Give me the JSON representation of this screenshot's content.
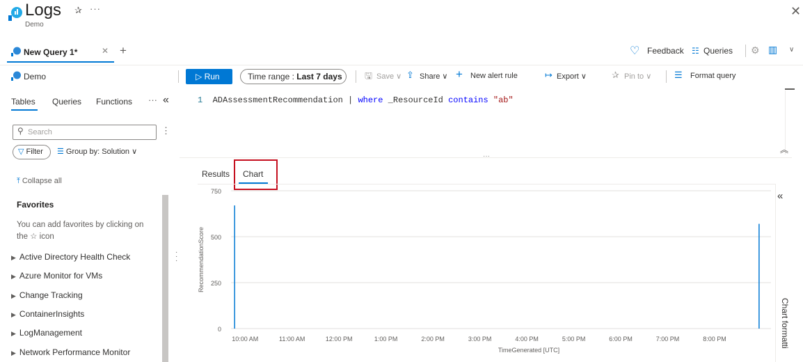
{
  "app": {
    "title": "Logs",
    "subtitle": "Demo"
  },
  "query_tab": {
    "label": "New Query 1*"
  },
  "top_actions": {
    "feedback": "Feedback",
    "queries": "Queries"
  },
  "scope": {
    "label": "Demo"
  },
  "toolbar": {
    "run": "Run",
    "time_range_label": "Time range : ",
    "time_range_value": "Last 7 days",
    "save": "Save",
    "share": "Share",
    "new_alert": "New alert rule",
    "export": "Export",
    "pin_to": "Pin to",
    "format_query": "Format query"
  },
  "left_panel": {
    "tabs": [
      "Tables",
      "Queries",
      "Functions"
    ],
    "search_placeholder": "Search",
    "filter": "Filter",
    "group_by": "Group by: Solution",
    "collapse_all": "Collapse all",
    "favorites_title": "Favorites",
    "favorites_hint": "You can add favorites by clicking on the ☆ icon",
    "solutions": [
      "Active Directory Health Check",
      "Azure Monitor for VMs",
      "Change Tracking",
      "ContainerInsights",
      "LogManagement",
      "Network Performance Monitor"
    ]
  },
  "editor": {
    "line_number": "1",
    "table": "ADAssessmentRecommendation",
    "pipe": " | ",
    "where": "where",
    "field": " _ResourceId ",
    "op": "contains",
    "value": "\"ab\""
  },
  "results_tabs": {
    "results": "Results",
    "chart": "Chart"
  },
  "chart_formatting_label": "Chart formatti",
  "colors": {
    "accent": "#0078d4",
    "highlight_box": "#c50f1f"
  },
  "chart_data": {
    "type": "bar",
    "ylabel": "RecommendationScore",
    "xlabel": "TimeGenerated [UTC]",
    "ylim": [
      0,
      750
    ],
    "yticks": [
      "0",
      "250",
      "500",
      "750"
    ],
    "xticks": [
      "10:00 AM",
      "11:00 AM",
      "12:00 PM",
      "1:00 PM",
      "2:00 PM",
      "3:00 PM",
      "4:00 PM",
      "5:00 PM",
      "6:00 PM",
      "7:00 PM",
      "8:00 PM"
    ],
    "xlim_hours": [
      9.7,
      21.2
    ],
    "series": [
      {
        "values": [
          {
            "x_hour": 9.78,
            "y": 670
          },
          {
            "x_hour": 20.95,
            "y": 570
          }
        ]
      }
    ]
  }
}
